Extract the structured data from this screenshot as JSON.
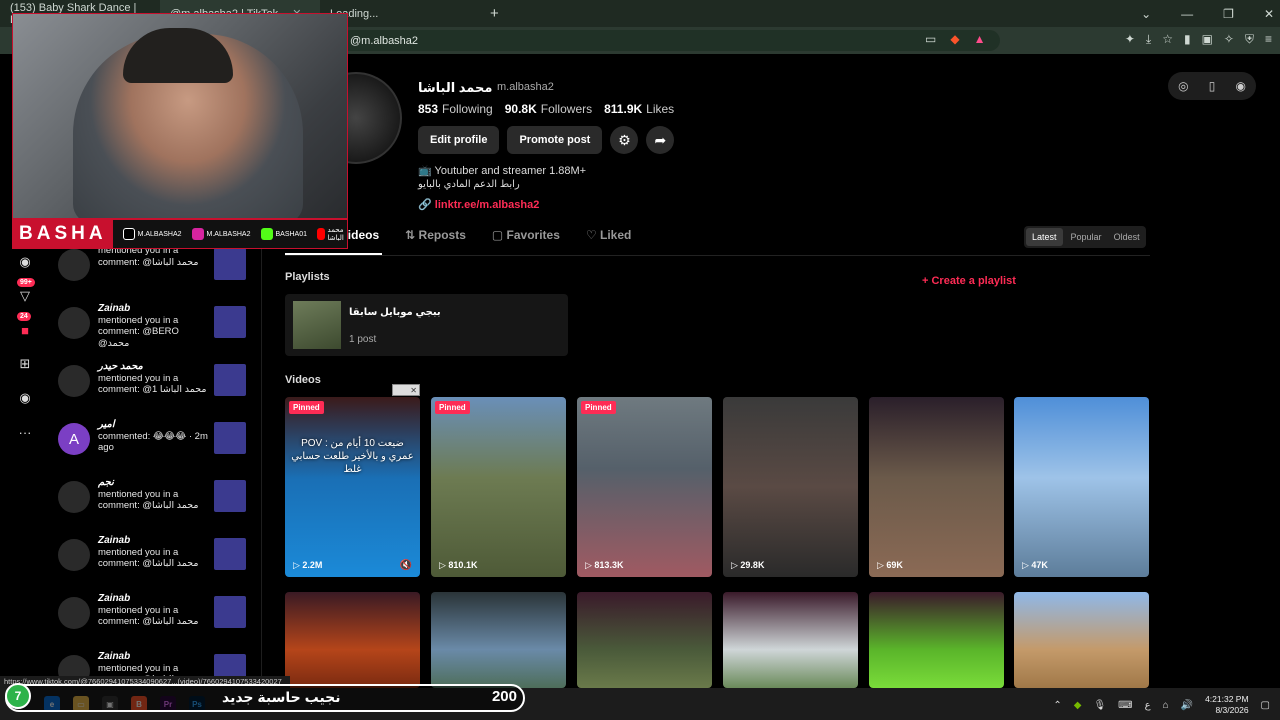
{
  "browser": {
    "tabs": [
      {
        "label": "(153) Baby Shark Dance | Baby..."
      },
      {
        "label": "@m.albasha2 | TikTok"
      },
      {
        "label": "Loading..."
      }
    ],
    "url": "@m.albasha2",
    "status_url": "https://www.tiktok.com/@76602941075334090627...(video)/7660294107533420027"
  },
  "webcam": {
    "brand": "BASHA",
    "socials": [
      {
        "label": "M.ALBASHA2",
        "color": "#000000"
      },
      {
        "label": "M.ALBASHA2",
        "color": "#d6249f"
      },
      {
        "label": "BASHA01",
        "color": "#53fc18"
      },
      {
        "label": "محمد الباشا",
        "color": "#ff0000"
      }
    ]
  },
  "rail": {
    "badges": [
      "99+",
      "24"
    ]
  },
  "notifications": [
    {
      "name": "",
      "text": "mentioned you in a comment: @محمد الباشا",
      "avatar": ""
    },
    {
      "name": "Zainab",
      "text": "mentioned you in a comment: @BERO @محمد",
      "avatar": ""
    },
    {
      "name": "محمد حيدر",
      "text": "mentioned you in a comment: @1 محمد الباشا",
      "avatar": ""
    },
    {
      "name": "امير",
      "text": "commented: 😂😂😂 · 2m ago",
      "avatar": "A"
    },
    {
      "name": "نجم",
      "text": "mentioned you in a comment: @محمد الباشا",
      "avatar": ""
    },
    {
      "name": "Zainab",
      "text": "mentioned you in a comment: @محمد الباشا",
      "avatar": ""
    },
    {
      "name": "Zainab",
      "text": "mentioned you in a comment: @محمد الباشا",
      "avatar": ""
    },
    {
      "name": "Zainab",
      "text": "mentioned you in a comment: @محمد الباشا",
      "avatar": ""
    }
  ],
  "profile": {
    "name": "محمد الباشا",
    "handle": "m.albasha2",
    "following": "853",
    "following_label": "Following",
    "followers": "90.8K",
    "followers_label": "Followers",
    "likes": "811.9K",
    "likes_label": "Likes",
    "edit_label": "Edit profile",
    "promote_label": "Promote post",
    "bio1": "📺 Youtuber and streamer 1.88M+",
    "bio2": "رابط الدعم المادي بالبايو",
    "link": "linktr.ee/m.albasha2"
  },
  "tabs": {
    "videos": "Videos",
    "reposts": "Reposts",
    "favorites": "Favorites",
    "liked": "Liked"
  },
  "sort": {
    "latest": "Latest",
    "popular": "Popular",
    "oldest": "Oldest"
  },
  "playlists": {
    "title": "Playlists",
    "create": "Create a playlist",
    "items": [
      {
        "name": "ببجي موبايل سابقا",
        "count": "1 post"
      }
    ]
  },
  "videos": {
    "title": "Videos",
    "pinned_label": "Pinned",
    "row1": [
      {
        "views": "2.2M",
        "pinned": true,
        "caption": "POV : ضيعت 10 أيام من عمري و بالأخير طلعت حسابي غلط",
        "bg": "linear-gradient(180deg,#3b1a1a 0%,#1a6fb5 45%,#1b8ad8 100%)"
      },
      {
        "views": "810.1K",
        "pinned": true,
        "caption": "",
        "bg": "linear-gradient(180deg,#6a8fb8 0%,#6d7b52 45%,#4e5a37 100%)"
      },
      {
        "views": "813.3K",
        "pinned": true,
        "caption": "",
        "bg": "linear-gradient(180deg,#6f7a80 0%,#55606a 40%,#a05a62 100%)"
      },
      {
        "views": "29.8K",
        "pinned": false,
        "caption": "",
        "bg": "linear-gradient(180deg,#3a3a3a 0%,#5a4a44 50%,#2a2a2a 100%)"
      },
      {
        "views": "69K",
        "pinned": false,
        "caption": "",
        "bg": "linear-gradient(180deg,#2a1f2a 0%,#6b5a4a 45%,#8b6a55 100%)"
      },
      {
        "views": "47K",
        "pinned": false,
        "caption": "",
        "bg": "linear-gradient(180deg,#4f8fd8 0%,#9ec3e8 45%,#5d7d9a 100%)"
      }
    ],
    "row2": [
      {
        "bg": "linear-gradient(180deg,#3a1a24 0%,#b5451a 60%,#7a2a10 100%)"
      },
      {
        "bg": "linear-gradient(180deg,#2a3438 0%,#6a8aa8 60%,#4e6e5a 100%)"
      },
      {
        "bg": "linear-gradient(180deg,#3a1a2a 0%,#4a5a3a 60%,#6a7a4a 100%)"
      },
      {
        "bg": "linear-gradient(180deg,#3a1a2a 0%,#cfd6d8 60%,#6a8a5a 100%)"
      },
      {
        "bg": "linear-gradient(180deg,#3a1a2a 0%,#5ab52a 60%,#7adc3a 100%)"
      },
      {
        "bg": "linear-gradient(180deg,#8fb8e8 0%,#c49a6a 60%,#a07848 100%)"
      }
    ]
  },
  "donation": {
    "level": "7",
    "text": "نجيب حاسبة جديد",
    "amount": "200"
  },
  "taskbar": {
    "time": "4:21:32 PM",
    "date": "8/3/2026",
    "lang": "ع"
  }
}
